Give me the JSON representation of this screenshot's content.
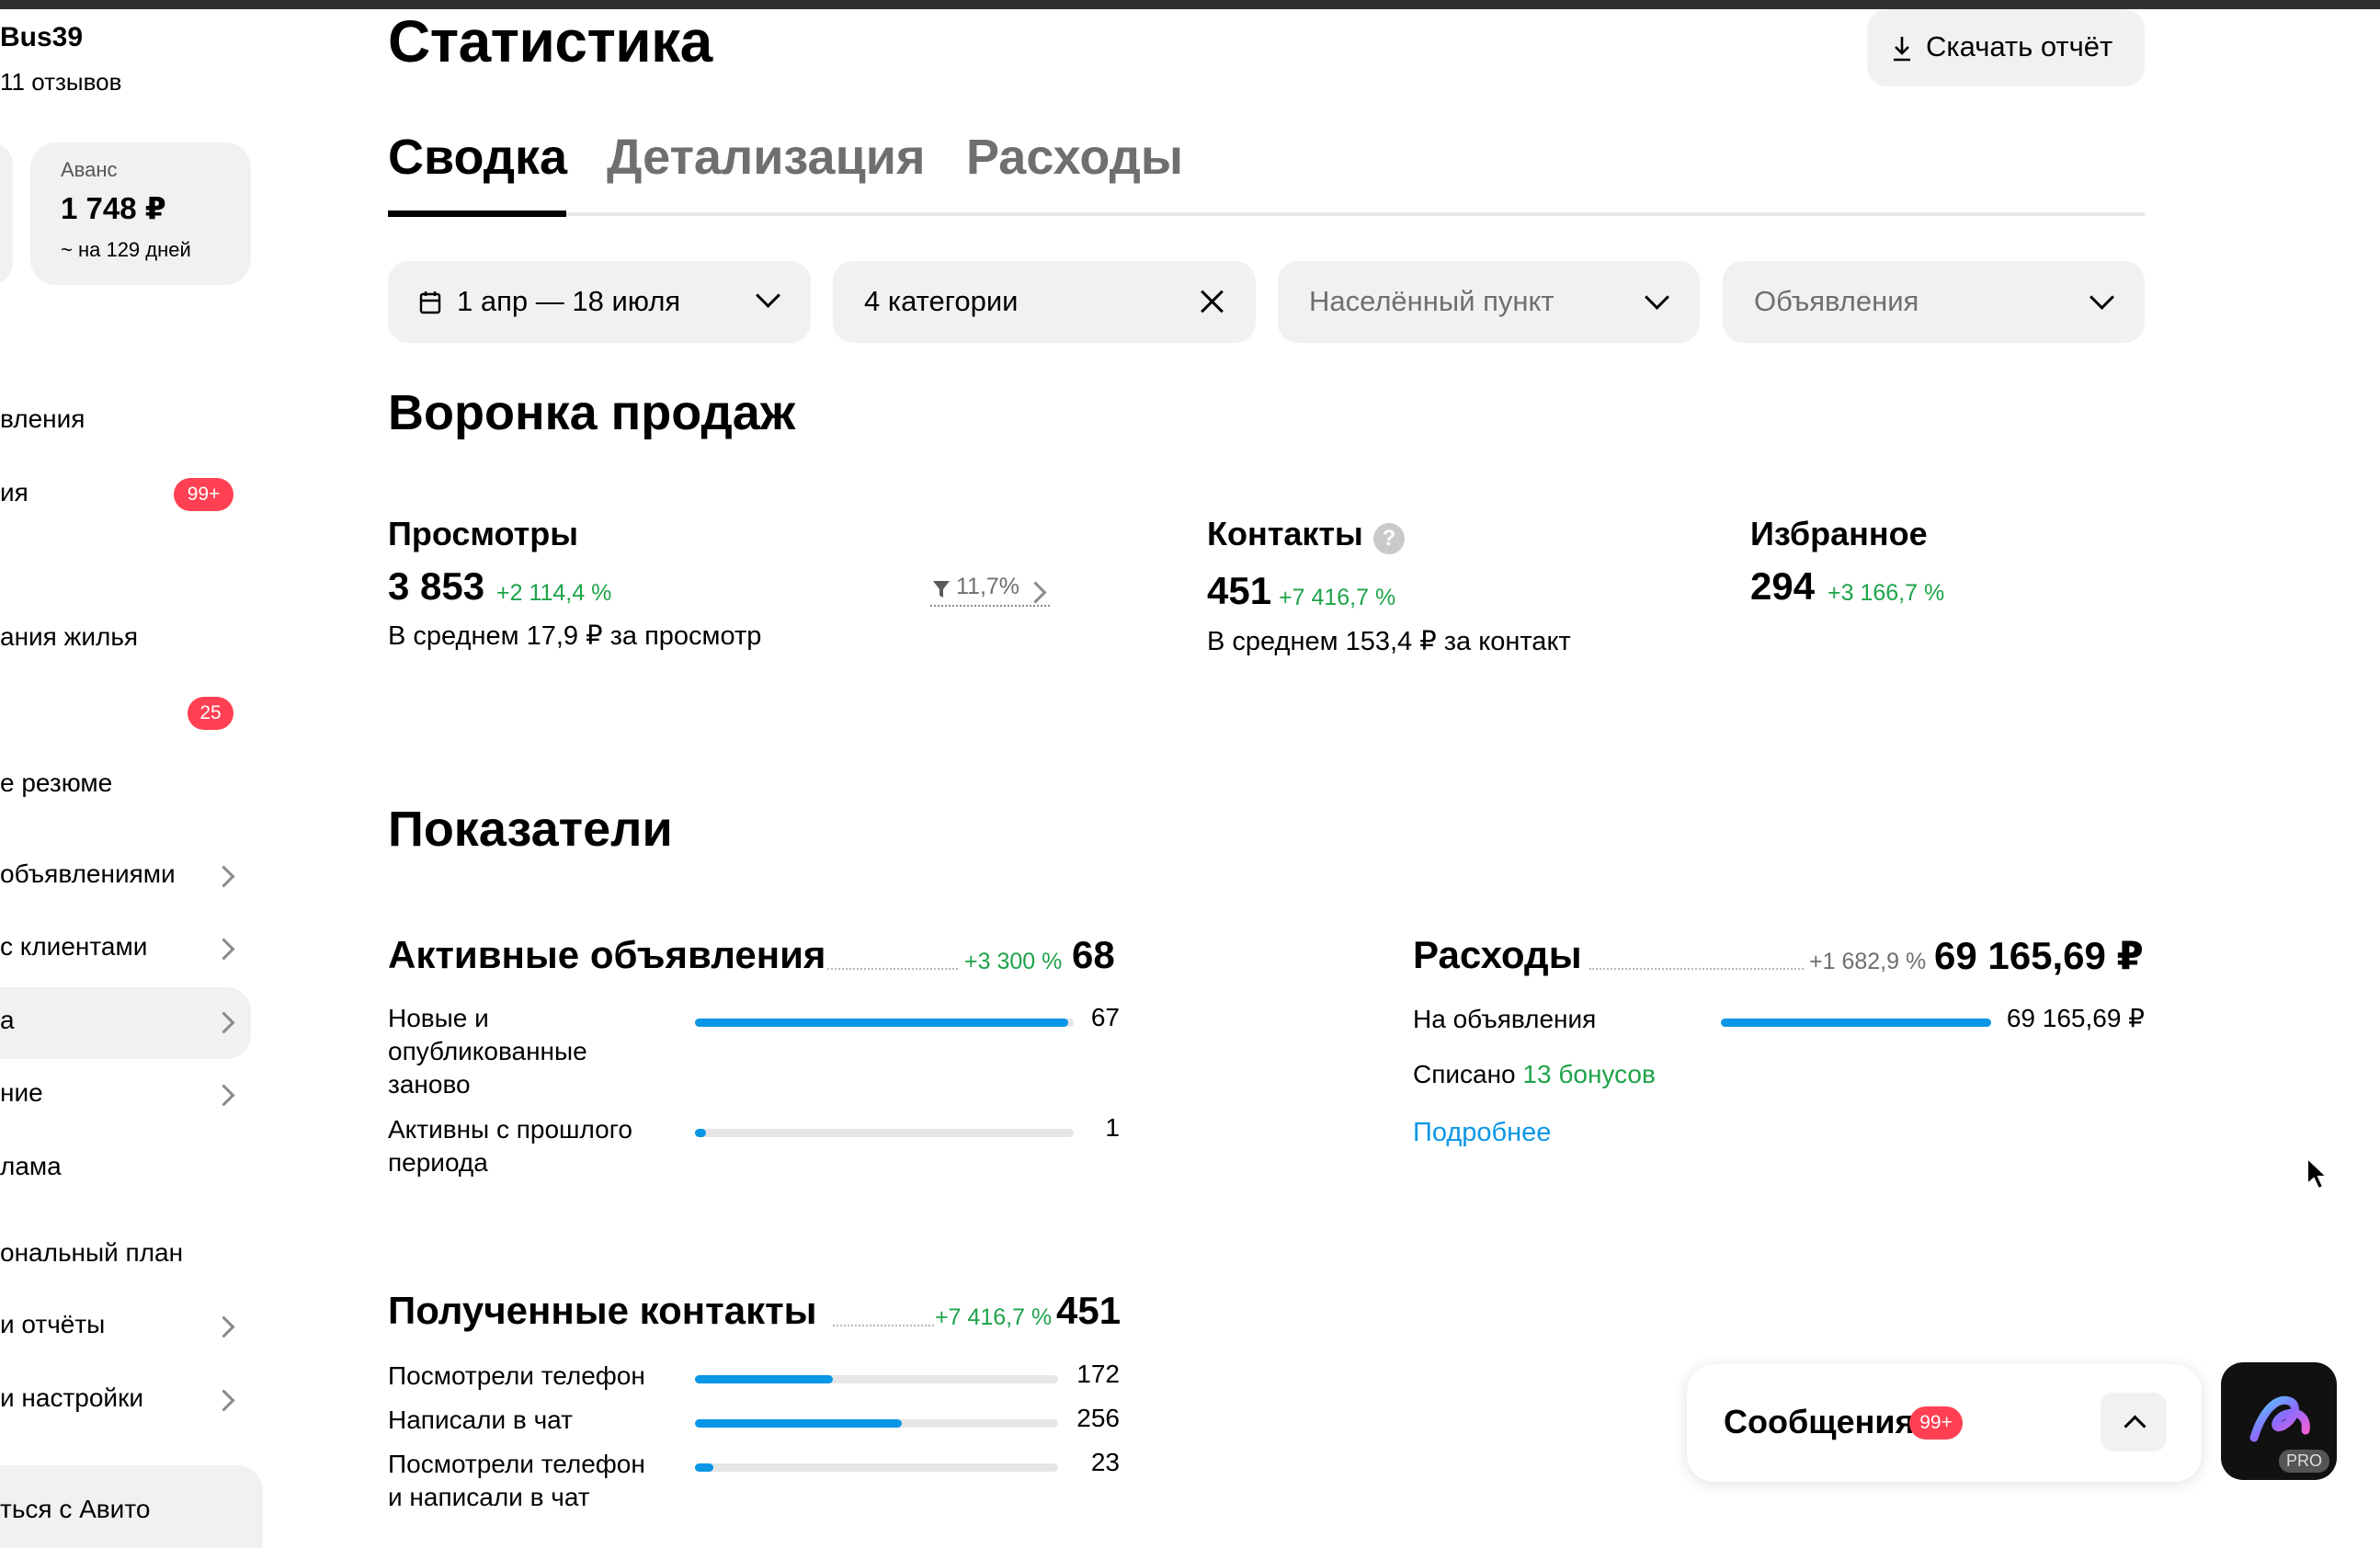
{
  "sidebar": {
    "profile_name": "Bus39",
    "reviews": "11 отзывов",
    "advance": {
      "label": "Аванс",
      "amount": "1 748 ₽",
      "days": "~ на 129 дней"
    },
    "items": [
      {
        "label": "вления"
      },
      {
        "label": "ия",
        "badge": "99+"
      },
      {
        "label": "ания жилья"
      },
      {
        "label": "",
        "badge": "25"
      },
      {
        "label": "е резюме"
      },
      {
        "label": "объявлениями"
      },
      {
        "label": "с клиентами"
      },
      {
        "label": "а"
      },
      {
        "label": "ние"
      },
      {
        "label": "лама"
      },
      {
        "label": "ональный план"
      },
      {
        "label": "и отчёты"
      },
      {
        "label": "и настройки"
      }
    ],
    "bottom_button": "ться с Авито"
  },
  "header": {
    "title": "Статистика",
    "download_label": "Скачать отчёт"
  },
  "tabs": [
    {
      "label": "Сводка",
      "active": true
    },
    {
      "label": "Детализация",
      "active": false
    },
    {
      "label": "Расходы",
      "active": false
    }
  ],
  "filters": {
    "period": "1 апр — 18 июля",
    "categories": "4 категории",
    "locality_placeholder": "Населённый пункт",
    "ads_placeholder": "Объявления"
  },
  "funnel": {
    "title": "Воронка продаж",
    "views": {
      "label": "Просмотры",
      "value": "3 853",
      "delta": "+2 114,4 %",
      "avg": "В среднем 17,9 ₽ за просмотр",
      "conversion": "11,7%"
    },
    "contacts": {
      "label": "Контакты",
      "value": "451",
      "delta": "+7 416,7 %",
      "avg": "В среднем 153,4 ₽ за контакт",
      "help": "?"
    },
    "favorites": {
      "label": "Избранное",
      "value": "294",
      "delta": "+3 166,7 %"
    }
  },
  "indicators": {
    "title": "Показатели",
    "active_ads": {
      "title": "Активные объявления",
      "delta": "+3 300 %",
      "total": "68",
      "rows": [
        {
          "label": "Новые и опубликованные заново",
          "value": "67",
          "fraction": 0.985
        },
        {
          "label": "Активны с прошлого периода",
          "value": "1",
          "fraction": 0.03
        }
      ]
    },
    "expenses": {
      "title": "Расходы",
      "delta": "+1 682,9 %",
      "total": "69 165,69 ₽",
      "row_label": "На объявления",
      "row_value": "69 165,69 ₽",
      "row_fraction": 1.0,
      "written_off_prefix": "Списано",
      "written_off_bonus": "13 бонусов",
      "more_link": "Подробнее"
    },
    "contacts_received": {
      "title": "Полученные контакты",
      "delta": "+7 416,7 %",
      "total": "451",
      "rows": [
        {
          "label": "Посмотрели телефон",
          "value": "172",
          "fraction": 0.38
        },
        {
          "label": "Написали в чат",
          "value": "256",
          "fraction": 0.57
        },
        {
          "label": "Посмотрели телефон и написали в чат",
          "value": "23",
          "fraction": 0.05
        }
      ]
    }
  },
  "messages_widget": {
    "label": "Сообщения",
    "badge": "99+"
  },
  "pro_widget": {
    "tag": "PRO"
  },
  "colors": {
    "accent_blue": "#0a96e6",
    "positive_green": "#1ea34a",
    "badge_red": "#ff4053"
  }
}
